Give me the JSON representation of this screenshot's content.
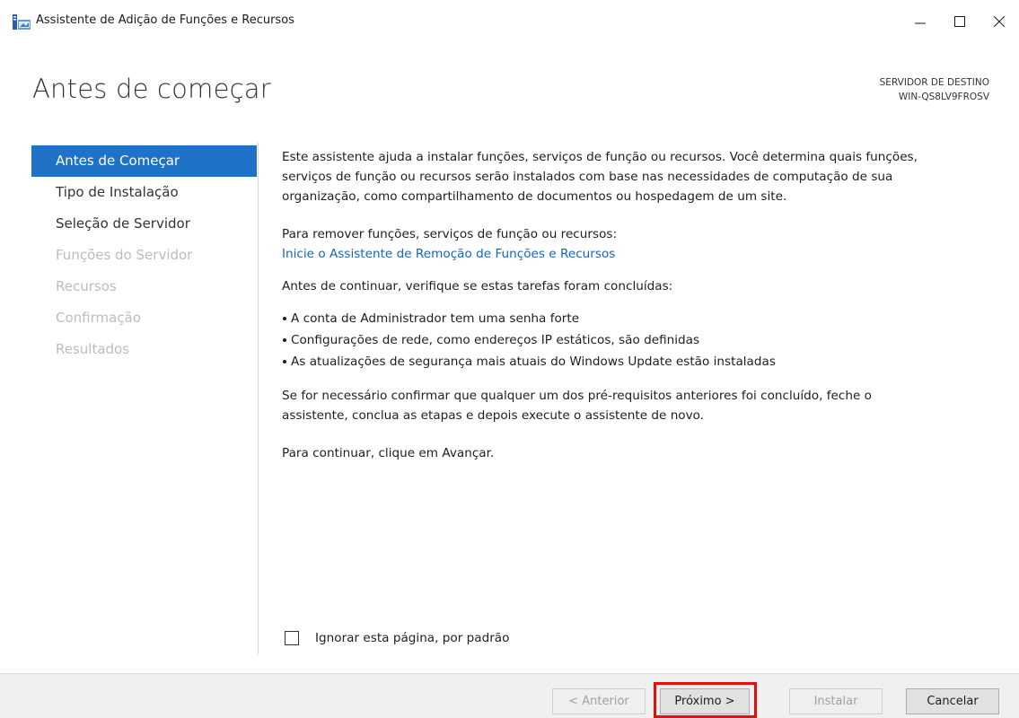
{
  "window": {
    "title": "Assistente de Adição de Funções e Recursos",
    "icon": "server-manager-wizard-icon",
    "controls": [
      "minimize-icon",
      "maximize-icon",
      "close-icon"
    ]
  },
  "header": {
    "page_title": "Antes de começar",
    "destination_label": "SERVIDOR DE DESTINO",
    "destination_server": "WIN-QS8LV9FROSV"
  },
  "nav": {
    "items": [
      {
        "label": "Antes de Começar",
        "state": "active"
      },
      {
        "label": "Tipo de Instalação",
        "state": "enabled"
      },
      {
        "label": "Seleção de Servidor",
        "state": "enabled"
      },
      {
        "label": "Funções do Servidor",
        "state": "disabled"
      },
      {
        "label": "Recursos",
        "state": "disabled"
      },
      {
        "label": "Confirmação",
        "state": "disabled"
      },
      {
        "label": "Resultados",
        "state": "disabled"
      }
    ]
  },
  "content": {
    "intro_lines": [
      "Este assistente ajuda a instalar funções, serviços de função ou recursos. Você determina quais funções,",
      "serviços de função ou recursos serão instalados com base nas necessidades de computação de sua",
      "organização, como compartilhamento de documentos ou hospedagem de um site."
    ],
    "remove_text": "Para remover funções, serviços de função ou recursos:",
    "remove_link": "Inicie o Assistente de Remoção de Funções e Recursos",
    "checklist_intro": "Antes de continuar, verifique se estas tarefas foram concluídas:",
    "checklist": [
      "A conta de Administrador tem uma senha forte",
      "Configurações de rede, como endereços IP estáticos, são definidas",
      "As atualizações de segurança mais atuais do Windows Update estão instaladas"
    ],
    "prereq_lines": [
      "Se for necessário confirmar que qualquer um dos pré-requisitos anteriores foi concluído, feche o",
      "assistente, conclua as etapas e depois execute o assistente de novo."
    ],
    "continue_text": "Para continuar, clique em Avançar."
  },
  "skip_page": {
    "label": "Ignorar esta página, por padrão",
    "checked": false
  },
  "footer": {
    "previous_label": "< Anterior",
    "next_label": "Próximo >",
    "install_label": "Instalar",
    "cancel_label": "Cancelar"
  },
  "colors": {
    "nav_active_bg": "#1f72c8",
    "link": "#1a64b7",
    "highlight": "#e01010"
  }
}
